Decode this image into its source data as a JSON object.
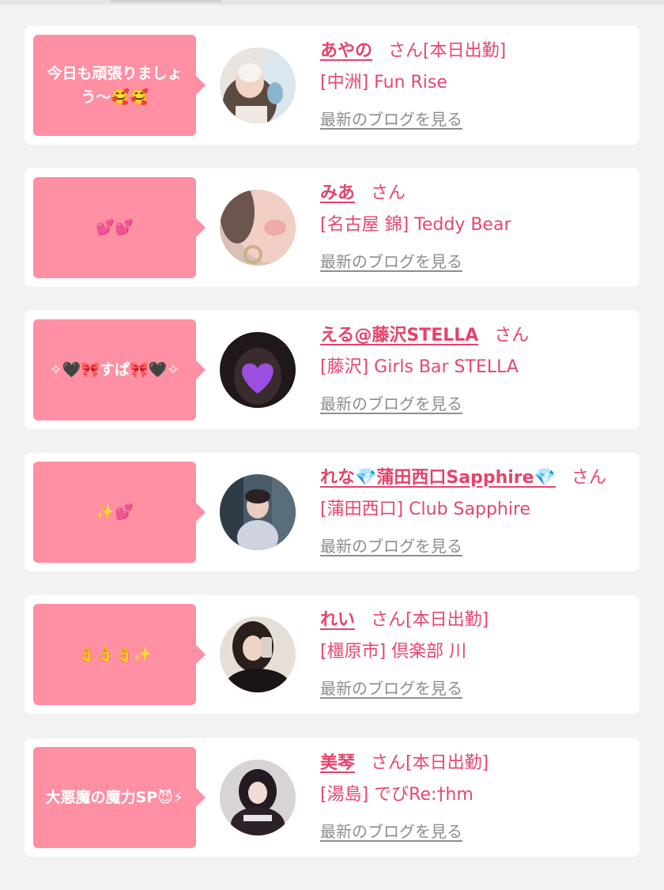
{
  "colors": {
    "bubble": "#ff8fa3",
    "name": "#e5436a",
    "text": "#e8456d",
    "link": "#8d8d8d",
    "background": "#f2f2f2"
  },
  "items": [
    {
      "comment": "今日も頑張りましょう〜🥰🥰",
      "name": "あやの",
      "suffix": "さん[本日出勤]",
      "shop": "[中洲] Fun Rise",
      "blog_link": "最新のブログを見る",
      "avatar_icon": "photo-avatar"
    },
    {
      "comment": "💕💕",
      "name": "みあ",
      "suffix": "さん",
      "shop": "[名古屋 錦] Teddy Bear",
      "blog_link": "最新のブログを見る",
      "avatar_icon": "photo-avatar"
    },
    {
      "comment": "✧🖤🎀すぱ🎀🖤✧",
      "name": "える@藤沢STELLA",
      "suffix": "さん",
      "shop": "[藤沢] Girls Bar STELLA",
      "blog_link": "最新のブログを見る",
      "avatar_icon": "photo-avatar-purple-heart"
    },
    {
      "comment": "✨💕",
      "name": "れな💎蒲田西口Sapphire💎",
      "suffix": "さん",
      "shop": "[蒲田西口] Club Sapphire",
      "blog_link": "最新のブログを見る",
      "avatar_icon": "photo-avatar"
    },
    {
      "comment": "👌👌👌✨",
      "name": "れい",
      "suffix": "さん[本日出勤]",
      "shop": "[橿原市] 倶楽部 川",
      "blog_link": "最新のブログを見る",
      "avatar_icon": "photo-avatar"
    },
    {
      "comment": "大悪魔の魔力SP😈⚡",
      "name": "美琴",
      "suffix": "さん[本日出勤]",
      "shop": "[湯島] でびRe:†hm",
      "blog_link": "最新のブログを見る",
      "avatar_icon": "photo-avatar"
    }
  ]
}
